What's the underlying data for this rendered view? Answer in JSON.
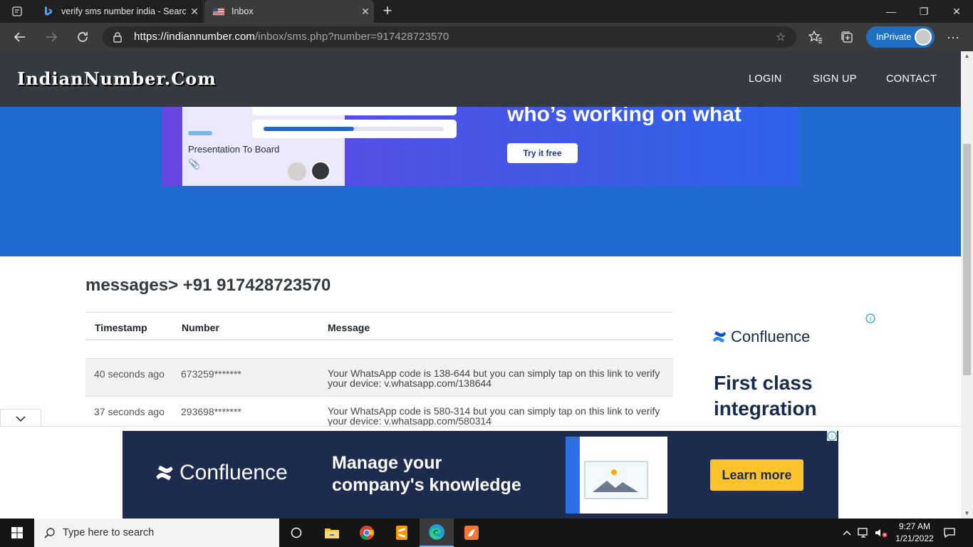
{
  "browser": {
    "tabs": [
      {
        "title": "verify sms number india - Search",
        "close": "✕"
      },
      {
        "title": "Inbox",
        "close": "✕"
      }
    ],
    "new_tab": "+",
    "window_controls": {
      "minimize": "—",
      "restore": "❐",
      "close": "✕"
    },
    "url_host": "https://indiannumber.com",
    "url_path": "/inbox/sms.php?number=917428723570",
    "inprivate_label": "InPrivate"
  },
  "site": {
    "logo": "IndianNumber.Com",
    "nav": [
      "LOGIN",
      "SIGN UP",
      "CONTACT"
    ]
  },
  "hero_ad": {
    "headline": "who’s working on what",
    "card_title": "Presentation To Board",
    "cta": "Try it free",
    "progress": 0.5
  },
  "page": {
    "title": "messages> +91 917428723570"
  },
  "table": {
    "headers": [
      "Timestamp",
      "Number",
      "Message"
    ],
    "rows": [
      {
        "timestamp": "40 seconds ago",
        "number": "673259*******",
        "message": "Your WhatsApp code is 138-644 but you can simply tap on this link to verify your device: v.whatsapp.com/138644"
      },
      {
        "timestamp": "37 seconds ago",
        "number": "293698*******",
        "message": "Your WhatsApp code is 580-314 but you can simply tap on this link to verify your device: v.whatsapp.com/580314"
      }
    ]
  },
  "side_ad": {
    "brand": "Confluence",
    "tagline_line1": "First class",
    "tagline_line2": "integration",
    "info": "ⓘ"
  },
  "banner_ad": {
    "brand": "Confluence",
    "tagline_line1": "Manage your",
    "tagline_line2": "company's knowledge",
    "cta": "Learn more",
    "info": "ⓘ"
  },
  "taskbar": {
    "search_placeholder": "Type here to search",
    "time": "9:27 AM",
    "date": "1/21/2022"
  },
  "colors": {
    "header_bg": "#343a40",
    "hero_bg": "#1f6ad1",
    "banner_bg": "#1d2b4f",
    "cta_yellow": "#ffc32b",
    "inprivate_blue": "#1f6fc5"
  }
}
